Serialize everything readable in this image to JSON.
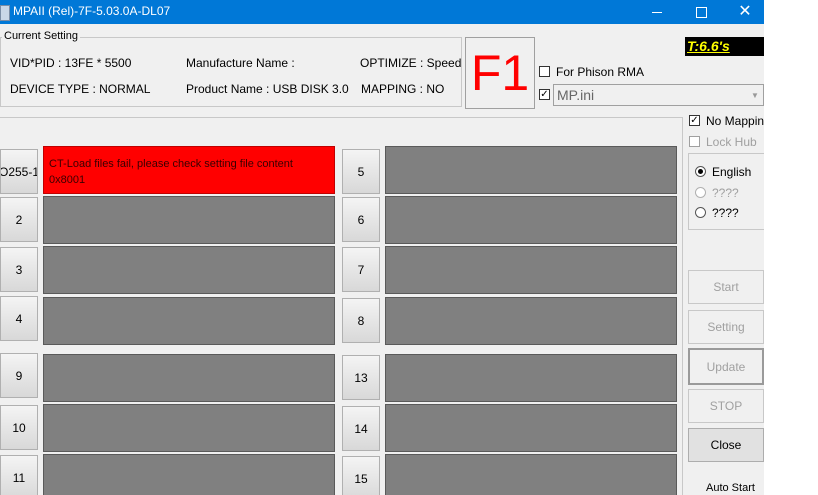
{
  "window": {
    "title": "MPAII (Rel)-7F-5.03.0A-DL07"
  },
  "current_setting": {
    "group_label": "Current Setting",
    "vid_pid": "VID*PID : 13FE * 5500",
    "device_type": "DEVICE TYPE : NORMAL",
    "manufacture_name": "Manufacture Name :",
    "product_name": "Product Name : USB DISK 3.0",
    "optimize": "OPTIMIZE : Speed",
    "mapping": "MAPPING : NO"
  },
  "f1_label": "F1",
  "for_phison_rma": {
    "label": "For Phison RMA",
    "checked": false
  },
  "ini_file": {
    "checked": true,
    "value": "MP.ini"
  },
  "timer": "T:6.6's",
  "ports": {
    "left": [
      {
        "label": "O255-1",
        "status": "error",
        "message_line1": "CT-Load files fail, please check setting file content",
        "message_line2": "0x8001"
      },
      {
        "label": "2"
      },
      {
        "label": "3"
      },
      {
        "label": "4"
      },
      {
        "label": "9"
      },
      {
        "label": "10"
      },
      {
        "label": "11"
      }
    ],
    "right": [
      {
        "label": "5"
      },
      {
        "label": "6"
      },
      {
        "label": "7"
      },
      {
        "label": "8"
      },
      {
        "label": "13"
      },
      {
        "label": "14"
      },
      {
        "label": "15"
      }
    ]
  },
  "options": {
    "no_mapping": {
      "label": "No Mapping",
      "checked": true
    },
    "lock_hub": {
      "label": "Lock Hub",
      "checked": false,
      "disabled": true
    }
  },
  "language": {
    "options": [
      {
        "label": "English",
        "selected": true,
        "disabled": false
      },
      {
        "label": "????",
        "selected": false,
        "disabled": true
      },
      {
        "label": "????",
        "selected": false,
        "disabled": false
      }
    ]
  },
  "buttons": {
    "start": "Start",
    "setting": "Setting",
    "update": "Update",
    "stop": "STOP",
    "close": "Close",
    "auto_start": "Auto Start"
  }
}
